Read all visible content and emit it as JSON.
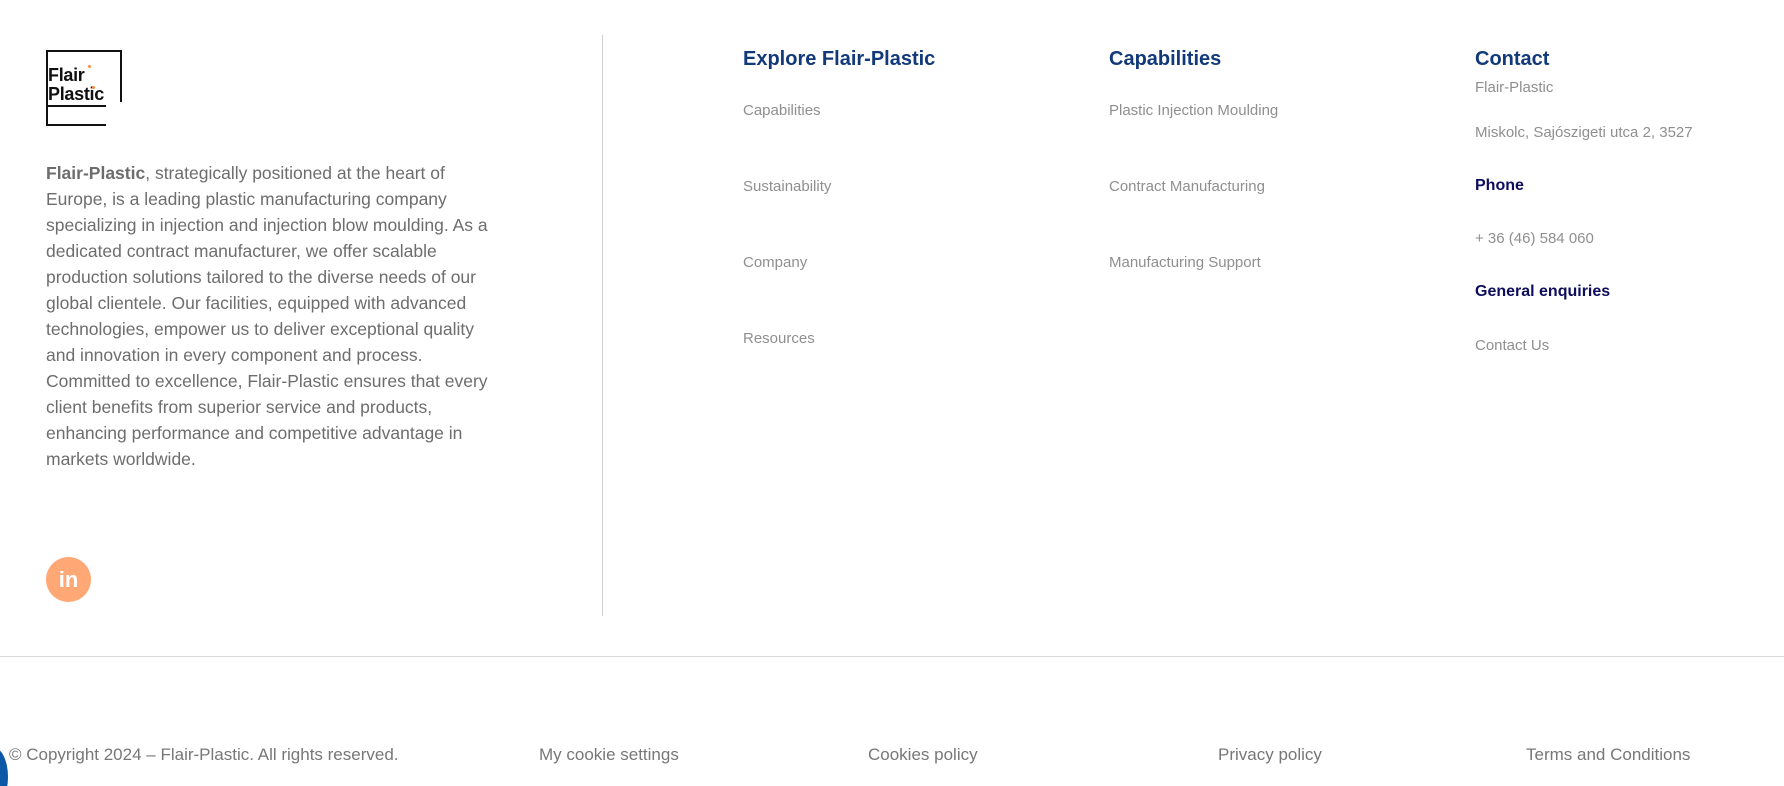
{
  "brand": {
    "logo_line1": "Flair",
    "logo_line2": "Plastic",
    "name_bold": "Flair-Plastic",
    "description": ", strategically positioned at the heart of Europe, is a leading plastic manufacturing company specializing in injection and injection blow moulding. As a dedicated contract manufacturer, we offer scalable production solutions tailored to the diverse needs of our global clientele. Our facilities, equipped with advanced technologies, empower us to deliver exceptional quality and innovation in every component and process. Committed to excellence, Flair-Plastic ensures that every client benefits from superior service and products, enhancing performance and competitive advantage in markets worldwide.",
    "social_linkedin_glyph": "in"
  },
  "explore": {
    "title": "Explore Flair-Plastic",
    "links": [
      "Capabilities",
      "Sustainability",
      "Company",
      "Resources"
    ]
  },
  "capabilities": {
    "title": "Capabilities",
    "links": [
      "Plastic Injection Moulding",
      "Contract Manufacturing",
      "Manufacturing Support"
    ]
  },
  "contact": {
    "title": "Contact",
    "company": "Flair-Plastic",
    "address": "Miskolc, Sajószigeti utca 2, 3527",
    "phone_title": "Phone",
    "phone": "+ 36 (46) 584 060",
    "enquiries_title": "General enquiries",
    "enquiries_link": "Contact Us"
  },
  "footer": {
    "copyright": "© Copyright 2024 – Flair-Plastic. All rights reserved.",
    "cookie_settings": "My cookie settings",
    "cookies_policy": "Cookies policy",
    "privacy_policy": "Privacy policy",
    "terms": "Terms and Conditions"
  },
  "colors": {
    "heading": "#123a7a",
    "subheading": "#0d0d5c",
    "link": "#8f8f8f",
    "body_text": "#6d6d6d",
    "linkedin_bg": "#ffa876",
    "chat_bubble": "#0a58a6"
  }
}
